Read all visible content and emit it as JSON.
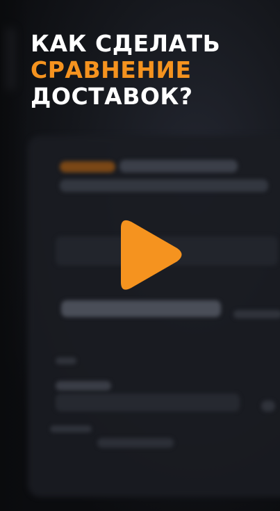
{
  "title": {
    "line1": "КАК СДЕЛАТЬ",
    "line2": "СРАВНЕНИЕ",
    "line3": "ДОСТАВОК?"
  },
  "colors": {
    "accent": "#f5931f",
    "text": "#ffffff",
    "background": "#0b0c0f"
  },
  "icons": {
    "play": "play-icon"
  }
}
